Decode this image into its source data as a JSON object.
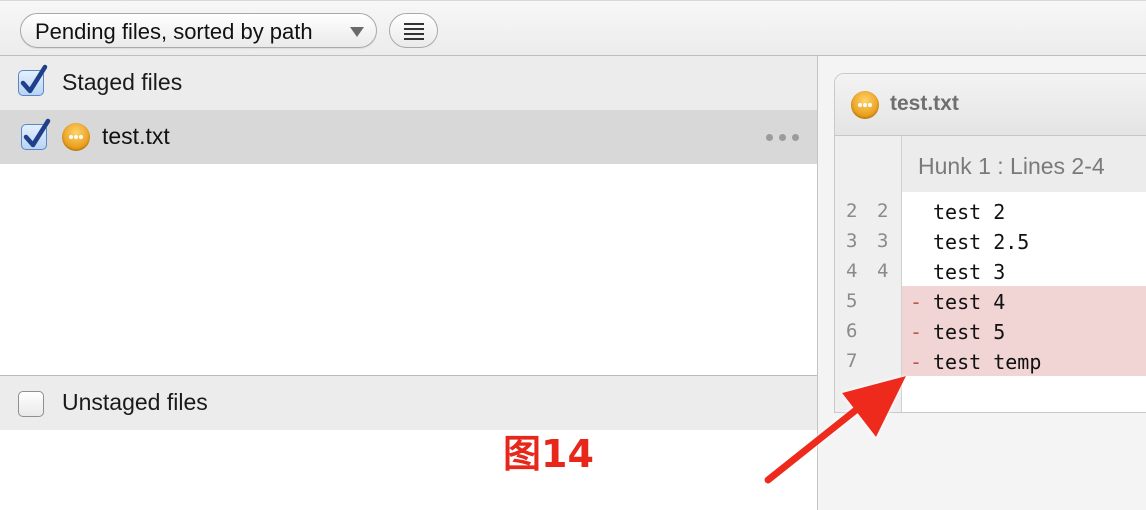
{
  "toolbar": {
    "sort_label": "Pending files, sorted by path",
    "menu_icon": "list-icon"
  },
  "staged": {
    "header_label": "Staged files",
    "checked": true,
    "files": [
      {
        "name": "test.txt",
        "checked": true,
        "status_icon": "modified-status-icon"
      }
    ]
  },
  "unstaged": {
    "header_label": "Unstaged files",
    "checked": false,
    "files": []
  },
  "diff": {
    "file_name": "test.txt",
    "hunk_label": "Hunk 1 : Lines 2-4",
    "lines": [
      {
        "old": "2",
        "new": "2",
        "marker": "",
        "text": "test 2",
        "type": "context"
      },
      {
        "old": "3",
        "new": "3",
        "marker": "",
        "text": "test 2.5",
        "type": "context"
      },
      {
        "old": "4",
        "new": "4",
        "marker": "",
        "text": "test 3",
        "type": "context"
      },
      {
        "old": "5",
        "new": "",
        "marker": "-",
        "text": "test 4",
        "type": "removed"
      },
      {
        "old": "6",
        "new": "",
        "marker": "-",
        "text": "test 5",
        "type": "removed"
      },
      {
        "old": "7",
        "new": "",
        "marker": "-",
        "text": "test temp",
        "type": "removed"
      }
    ]
  },
  "annotation": {
    "label": "图14",
    "color": "#e8271b"
  },
  "colors": {
    "removed_line_bg": "#f1d4d4",
    "selected_row_bg": "#d8d8d8",
    "checkbox_check": "#1f3f8a"
  }
}
